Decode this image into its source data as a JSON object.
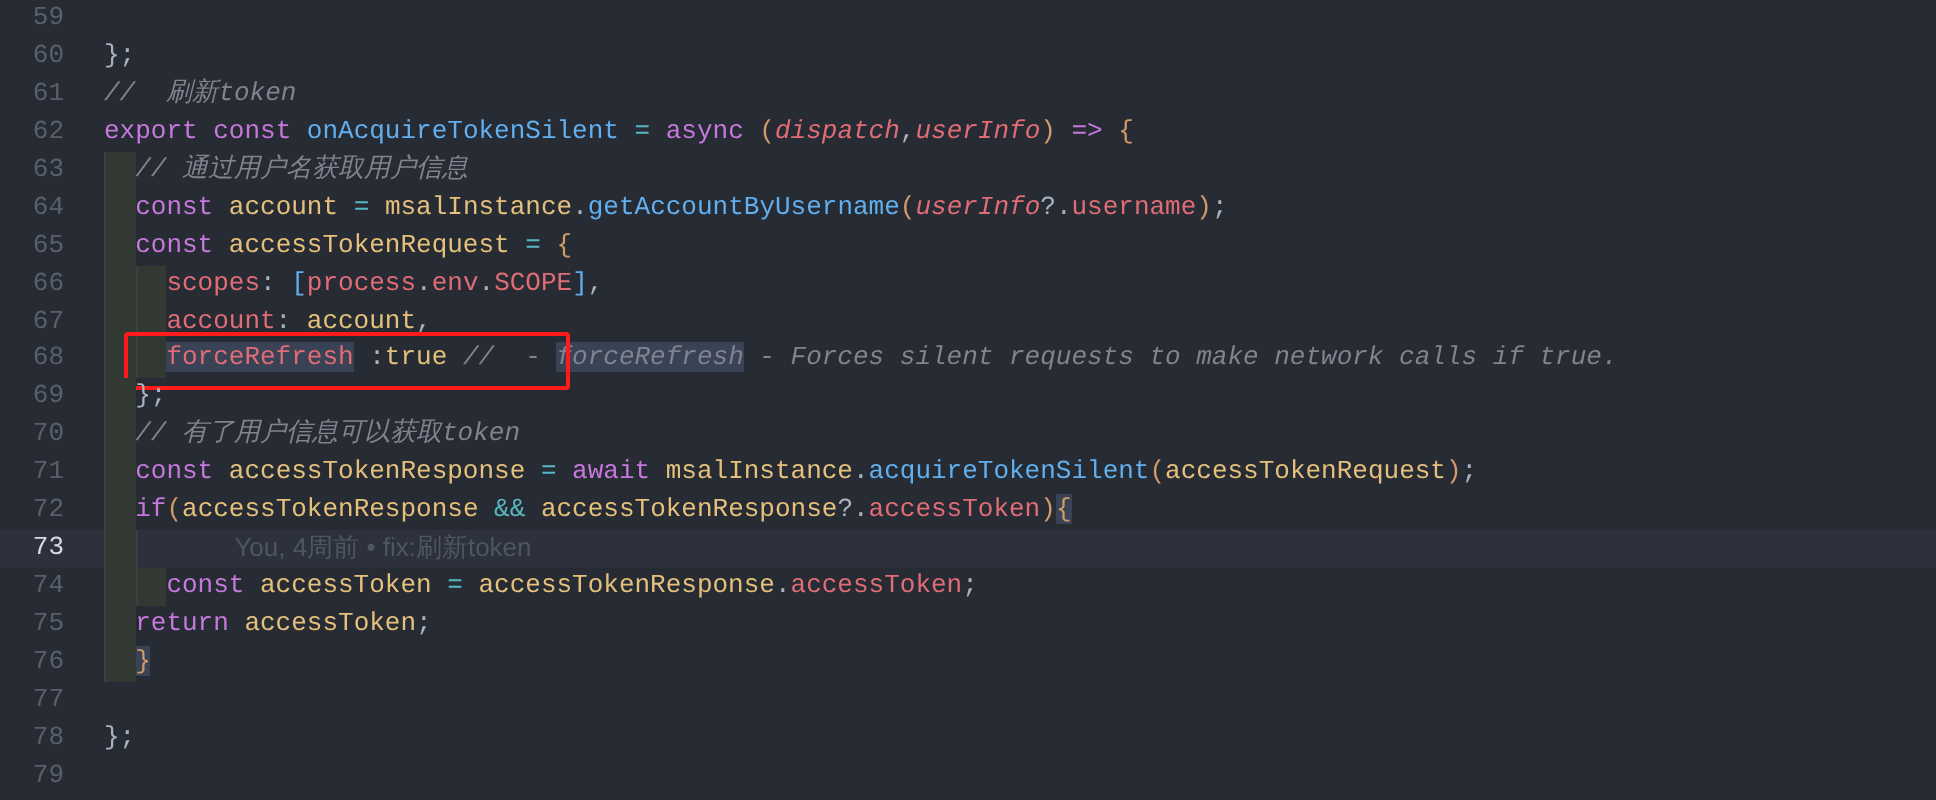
{
  "editor": {
    "lines": [
      {
        "number": "59"
      },
      {
        "number": "60",
        "tokens": [
          {
            "text": "};",
            "kind": "punct"
          }
        ]
      },
      {
        "number": "61",
        "tokens": [
          {
            "text": "//  刷新token",
            "kind": "comment"
          }
        ]
      },
      {
        "number": "62",
        "tokens": [
          {
            "text": "export",
            "kind": "kw"
          },
          {
            "text": " const",
            "kind": "kw"
          },
          {
            "text": " onAcquireTokenSilent",
            "kind": "fn"
          },
          {
            "text": " =",
            "kind": "op"
          },
          {
            "text": " async",
            "kind": "kw"
          },
          {
            "text": " (",
            "kind": "brace"
          },
          {
            "text": "dispatch",
            "kind": "param"
          },
          {
            "text": ",",
            "kind": "punct"
          },
          {
            "text": "userInfo",
            "kind": "param"
          },
          {
            "text": ")",
            "kind": "brace"
          },
          {
            "text": " =>",
            "kind": "kw"
          },
          {
            "text": " {",
            "kind": "brace"
          }
        ],
        "children": [
          {
            "number": "63",
            "tokens": [
              {
                "text": "// 通过用户名获取用户信息",
                "kind": "comment"
              }
            ]
          },
          {
            "number": "64",
            "tokens": [
              {
                "text": "const",
                "kind": "kw"
              },
              {
                "text": " account",
                "kind": "var"
              },
              {
                "text": " =",
                "kind": "op"
              },
              {
                "text": " msalInstance",
                "kind": "var"
              },
              {
                "text": ".",
                "kind": "punct"
              },
              {
                "text": "getAccountByUsername",
                "kind": "fn"
              },
              {
                "text": "(",
                "kind": "brace"
              },
              {
                "text": "userInfo",
                "kind": "param"
              },
              {
                "text": "?.",
                "kind": "punct"
              },
              {
                "text": "username",
                "kind": "prop"
              },
              {
                "text": ")",
                "kind": "brace"
              },
              {
                "text": ";",
                "kind": "punct"
              }
            ]
          },
          {
            "number": "65",
            "tokens": [
              {
                "text": "const",
                "kind": "kw"
              },
              {
                "text": " accessTokenRequest",
                "kind": "var"
              },
              {
                "text": " =",
                "kind": "op"
              },
              {
                "text": " {",
                "kind": "brace"
              }
            ],
            "children": [
              {
                "number": "66",
                "tokens": [
                  {
                    "text": "scopes",
                    "kind": "prop"
                  },
                  {
                    "text": ": ",
                    "kind": "punct"
                  },
                  {
                    "text": "[",
                    "kind": "fn"
                  },
                  {
                    "text": "process",
                    "kind": "prop"
                  },
                  {
                    "text": ".",
                    "kind": "punct"
                  },
                  {
                    "text": "env",
                    "kind": "prop"
                  },
                  {
                    "text": ".",
                    "kind": "punct"
                  },
                  {
                    "text": "SCOPE",
                    "kind": "prop"
                  },
                  {
                    "text": "]",
                    "kind": "fn"
                  },
                  {
                    "text": ",",
                    "kind": "punct"
                  }
                ]
              },
              {
                "number": "67",
                "tokens": [
                  {
                    "text": "account",
                    "kind": "prop"
                  },
                  {
                    "text": ": ",
                    "kind": "punct"
                  },
                  {
                    "text": "account",
                    "kind": "var"
                  },
                  {
                    "text": ",",
                    "kind": "punct"
                  }
                ]
              },
              {
                "number": "68",
                "annotated": true,
                "tokens": [
                  {
                    "text": "forceRefresh",
                    "kind": "prop",
                    "highlighted": true
                  },
                  {
                    "text": " :",
                    "kind": "punct"
                  },
                  {
                    "text": "true",
                    "kind": "var"
                  },
                  {
                    "text": " //  - ",
                    "kind": "comment"
                  },
                  {
                    "text": "forceRefresh",
                    "kind": "comment",
                    "highlighted": true
                  },
                  {
                    "text": " - Forces silent requests to make network calls if true.",
                    "kind": "comment"
                  }
                ]
              }
            ]
          },
          {
            "number": "69",
            "tokens": [
              {
                "text": "};",
                "kind": "punct"
              }
            ]
          },
          {
            "number": "70",
            "tokens": [
              {
                "text": "// 有了用户信息可以获取token",
                "kind": "comment"
              }
            ]
          },
          {
            "number": "71",
            "tokens": [
              {
                "text": "const",
                "kind": "kw"
              },
              {
                "text": " accessTokenResponse",
                "kind": "var"
              },
              {
                "text": " =",
                "kind": "op"
              },
              {
                "text": " await",
                "kind": "kw"
              },
              {
                "text": " msalInstance",
                "kind": "var"
              },
              {
                "text": ".",
                "kind": "punct"
              },
              {
                "text": "acquireTokenSilent",
                "kind": "fn"
              },
              {
                "text": "(",
                "kind": "brace"
              },
              {
                "text": "accessTokenRequest",
                "kind": "var"
              },
              {
                "text": ")",
                "kind": "brace"
              },
              {
                "text": ";",
                "kind": "punct"
              }
            ]
          },
          {
            "number": "72",
            "tokens": [
              {
                "text": "if",
                "kind": "kw"
              },
              {
                "text": "(",
                "kind": "brace"
              },
              {
                "text": "accessTokenResponse",
                "kind": "var"
              },
              {
                "text": " &&",
                "kind": "op"
              },
              {
                "text": " accessTokenResponse",
                "kind": "var"
              },
              {
                "text": "?.",
                "kind": "punct"
              },
              {
                "text": "accessToken",
                "kind": "prop"
              },
              {
                "text": ")",
                "kind": "brace"
              },
              {
                "text": "{",
                "kind": "brace",
                "highlighted": true
              }
            ],
            "children": [
              {
                "number": "73",
                "current": true,
                "blame": "You, 4周前 • fix:刷新token"
              },
              {
                "number": "74",
                "tokens": [
                  {
                    "text": "const",
                    "kind": "kw"
                  },
                  {
                    "text": " accessToken",
                    "kind": "var"
                  },
                  {
                    "text": " =",
                    "kind": "op"
                  },
                  {
                    "text": " accessTokenResponse",
                    "kind": "var"
                  },
                  {
                    "text": ".",
                    "kind": "punct"
                  },
                  {
                    "text": "accessToken",
                    "kind": "prop"
                  },
                  {
                    "text": ";",
                    "kind": "punct"
                  }
                ]
              }
            ]
          },
          {
            "number": "75",
            "tokens": [
              {
                "text": "return",
                "kind": "kw"
              },
              {
                "text": " accessToken",
                "kind": "var"
              },
              {
                "text": ";",
                "kind": "punct"
              }
            ]
          },
          {
            "number": "76",
            "tokens": [
              {
                "text": "}",
                "kind": "brace",
                "highlighted": true
              }
            ]
          }
        ]
      },
      {
        "number": "77"
      },
      {
        "number": "78",
        "tokens": [
          {
            "text": "};",
            "kind": "punct"
          }
        ]
      },
      {
        "number": "79"
      }
    ]
  }
}
